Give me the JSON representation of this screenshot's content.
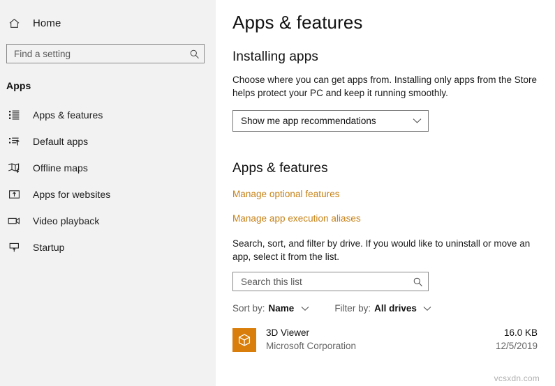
{
  "sidebar": {
    "home": {
      "label": "Home",
      "icon": "home-icon"
    },
    "search": {
      "value": "",
      "placeholder": "Find a setting",
      "icon": "search-icon"
    },
    "section_label": "Apps",
    "items": [
      {
        "label": "Apps & features",
        "icon": "list-bullets-icon",
        "selected": true
      },
      {
        "label": "Default apps",
        "icon": "list-arrow-icon",
        "selected": false
      },
      {
        "label": "Offline maps",
        "icon": "map-download-icon",
        "selected": false
      },
      {
        "label": "Apps for websites",
        "icon": "window-upload-icon",
        "selected": false
      },
      {
        "label": "Video playback",
        "icon": "video-camera-icon",
        "selected": false
      },
      {
        "label": "Startup",
        "icon": "monitor-up-icon",
        "selected": false
      }
    ]
  },
  "main": {
    "page_title": "Apps & features",
    "installing": {
      "heading": "Installing apps",
      "description": "Choose where you can get apps from. Installing only apps from the Store helps protect your PC and keep it running smoothly.",
      "dropdown": {
        "value": "Show me app recommendations",
        "icon": "chevron-down-icon"
      }
    },
    "features": {
      "heading": "Apps & features",
      "links": [
        {
          "label": "Manage optional features"
        },
        {
          "label": "Manage app execution aliases"
        }
      ],
      "description": "Search, sort, and filter by drive. If you would like to uninstall or move an app, select it from the list.",
      "search": {
        "value": "",
        "placeholder": "Search this list",
        "icon": "search-icon"
      },
      "sort": {
        "key": "Sort by:",
        "value": "Name",
        "icon": "chevron-down-icon"
      },
      "filter": {
        "key": "Filter by:",
        "value": "All drives",
        "icon": "chevron-down-icon"
      }
    },
    "apps": [
      {
        "name": "3D Viewer",
        "publisher": "Microsoft Corporation",
        "size": "16.0 KB",
        "date": "12/5/2019",
        "icon": "cube-3d-icon",
        "icon_color": "#d97e0a"
      }
    ]
  },
  "watermark": {
    "text": "vcsxdn.com"
  },
  "colors": {
    "sidebar_bg": "#f2f2f2",
    "main_bg": "#ffffff",
    "link_orange": "#c68014",
    "text_primary": "#111111",
    "text_secondary": "#666666",
    "border_gray": "#767676"
  }
}
